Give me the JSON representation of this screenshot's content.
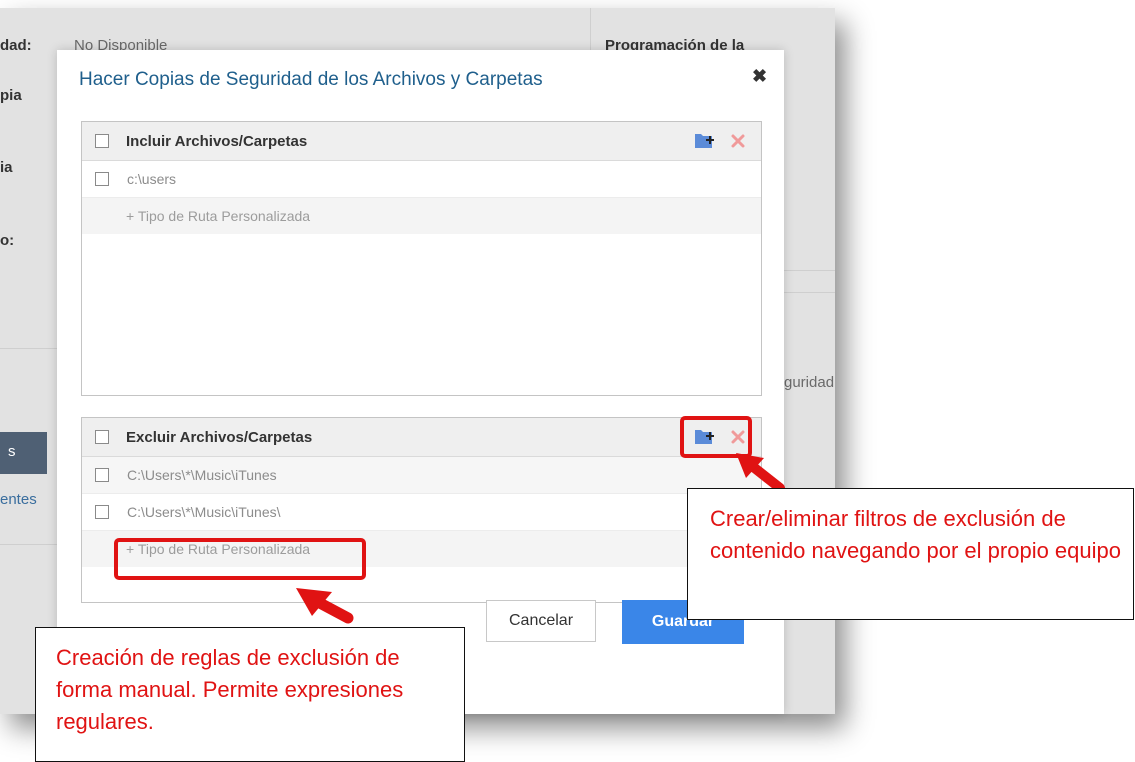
{
  "background": {
    "labels": [
      "dad:",
      "No Disponible",
      "Programación de la",
      "pia",
      "ia",
      "o:",
      "guridad",
      "s",
      "entes"
    ]
  },
  "modal": {
    "title": "Hacer Copias de Seguridad de los Archivos y Carpetas",
    "close_label": "✖",
    "include": {
      "title": "Incluir Archivos/Carpetas",
      "items": [
        "c:\\users"
      ],
      "add_custom_label": "+ Tipo de Ruta Personalizada"
    },
    "exclude": {
      "title": "Excluir Archivos/Carpetas",
      "items": [
        "C:\\Users\\*\\Music\\iTunes",
        "C:\\Users\\*\\Music\\iTunes\\"
      ],
      "add_custom_label": "+ Tipo de Ruta Personalizada"
    },
    "buttons": {
      "cancel": "Cancelar",
      "save": "Guardar"
    }
  },
  "callouts": {
    "right": "Crear/eliminar filtros de exclusión de contenido navegando por el propio equipo",
    "left": "Creación de reglas de exclusión de forma manual. Permite expresiones regulares."
  },
  "colors": {
    "title_blue": "#1f5f8c",
    "primary_button": "#3a86e8",
    "folder_icon": "#5b8bd8",
    "delete_icon": "#f09a9a",
    "annotation_red": "#e01313"
  },
  "icons": [
    "add-folder-icon",
    "delete-icon",
    "close-icon",
    "arrow-icon"
  ]
}
